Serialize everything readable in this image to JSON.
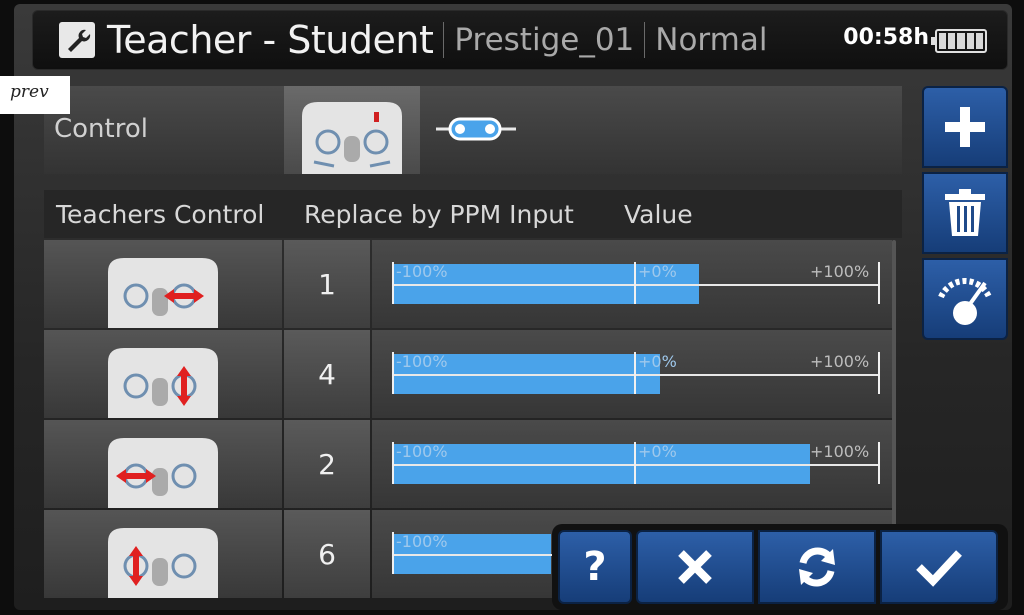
{
  "header": {
    "title": "Teacher - Student",
    "model": "Prestige_01",
    "mode": "Normal",
    "timer": "00:58h"
  },
  "note": {
    "text": "prev"
  },
  "control": {
    "label": "Control"
  },
  "table": {
    "headers": {
      "teacher": "Teachers Control",
      "replace": "Replace by PPM Input",
      "value": "Value"
    },
    "scale": {
      "min": "-100%",
      "mid": "+0%",
      "max": "+100%"
    },
    "rows": [
      {
        "stick": "right-stick-horizontal",
        "channel": "1",
        "value_percent": 26
      },
      {
        "stick": "right-stick-vertical",
        "channel": "4",
        "value_percent": 10
      },
      {
        "stick": "left-stick-horizontal",
        "channel": "2",
        "value_percent": 72
      },
      {
        "stick": "left-stick-vertical",
        "channel": "6",
        "value_percent": -35
      }
    ]
  },
  "toolbar": {
    "help_label": "?",
    "cancel_icon": "close-icon",
    "reset_icon": "refresh-icon",
    "ok_icon": "check-icon"
  },
  "side_buttons": [
    "add-icon",
    "trash-icon",
    "gauge-icon"
  ],
  "colors": {
    "accent": "#2d5fa8",
    "bar": "#4aa3ea",
    "arrow": "#e02020"
  }
}
